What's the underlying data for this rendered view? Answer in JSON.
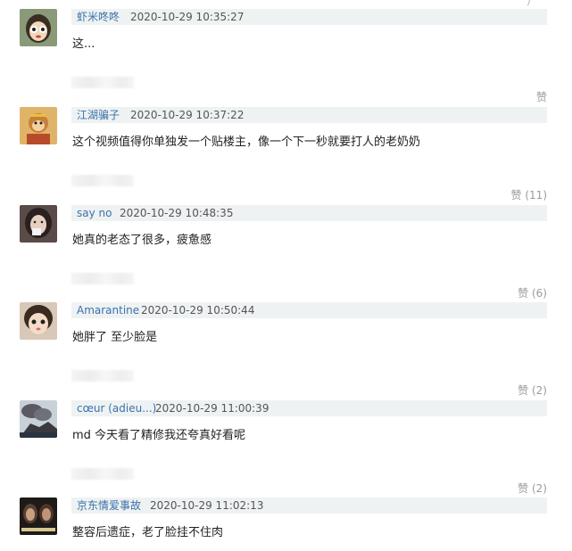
{
  "top_like": "）",
  "comments": [
    {
      "author": "虾米咚咚",
      "time": "2020-10-29 10:35:27",
      "text": "这...",
      "likes": "赞",
      "avatar_icon": "cartoon-girl-avatar-icon",
      "avatar_color": "#7a8a6a"
    },
    {
      "author": "江湖骗子",
      "time": "2020-10-29 10:37:22",
      "text": "这个视频值得你单独发一个贴楼主，像一个下一秒就要打人的老奶奶",
      "likes": "赞 (11)",
      "avatar_icon": "monkey-king-avatar-icon",
      "avatar_color": "#d8b070"
    },
    {
      "author": "say no",
      "time": "2020-10-29 10:48:35",
      "text": "她真的老态了很多，疲惫感",
      "likes": "赞 (6)",
      "avatar_icon": "girl-photo-avatar-icon",
      "avatar_color": "#4a4040"
    },
    {
      "author": "Amarantine",
      "time": "2020-10-29 10:50:44",
      "text": "她胖了 至少脸是",
      "likes": "赞 (2)",
      "avatar_icon": "child-photo-avatar-icon",
      "avatar_color": "#3a2a22"
    },
    {
      "author": "cœur (adieu...)",
      "time": "2020-10-29 11:00:39",
      "text": "md 今天看了精修我还夸真好看呢",
      "likes": "赞 (2)",
      "avatar_icon": "volcano-photo-avatar-icon",
      "avatar_color": "#6a7a88"
    },
    {
      "author": "京东情爱事故",
      "time": "2020-10-29 11:02:13",
      "text": "整容后遗症，老了脸挂不住肉",
      "likes": null,
      "avatar_icon": "women-photo-avatar-icon",
      "avatar_color": "#2a2420"
    }
  ]
}
